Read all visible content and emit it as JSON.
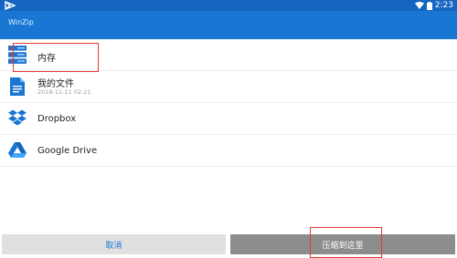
{
  "status": {
    "time": "2:23"
  },
  "app": {
    "title": "WinZip"
  },
  "locations": [
    {
      "label": "内存",
      "icon": "internal-storage-icon"
    },
    {
      "label": "我的文件",
      "sub": "2018-11-11 02:21",
      "icon": "document-icon"
    },
    {
      "label": "Dropbox",
      "icon": "dropbox-icon"
    },
    {
      "label": "Google Drive",
      "icon": "google-drive-icon"
    }
  ],
  "buttons": {
    "cancel": "取消",
    "compress": "压缩到这里"
  },
  "colors": {
    "primary": "#1976d2",
    "statusbar": "#1565c0",
    "highlight": "#e53935"
  }
}
